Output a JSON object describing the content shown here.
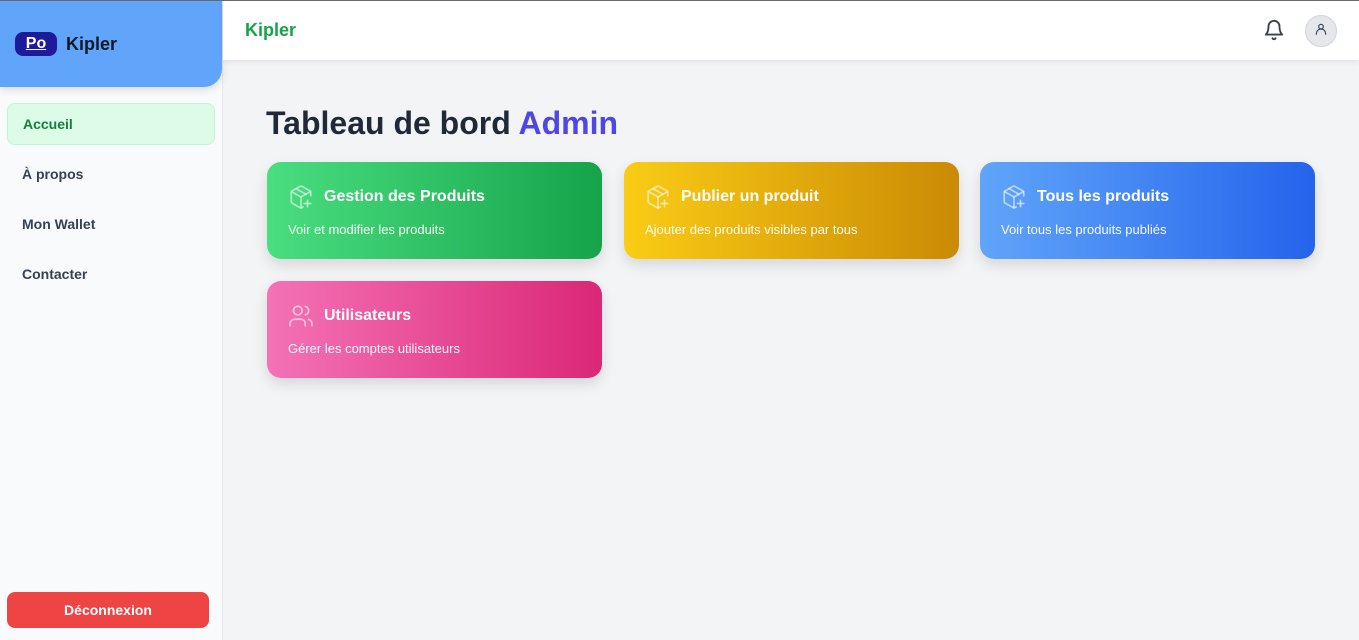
{
  "brand": {
    "logo_text": "Po",
    "name": "Kipler"
  },
  "sidebar": {
    "items": [
      {
        "label": "Accueil",
        "active": true
      },
      {
        "label": "À propos",
        "active": false
      },
      {
        "label": "Mon Wallet",
        "active": false
      },
      {
        "label": "Contacter",
        "active": false
      }
    ],
    "logout_label": "Déconnexion"
  },
  "header": {
    "title": "Kipler",
    "icons": [
      "bell-icon",
      "user-icon"
    ]
  },
  "main": {
    "title_prefix": "Tableau de bord",
    "title_accent": "Admin",
    "cards": [
      {
        "icon": "package-plus-icon",
        "title": "Gestion des Produits",
        "description": "Voir et modifier les produits",
        "color_from": "#4ade80",
        "color_to": "#16a34a"
      },
      {
        "icon": "package-plus-icon",
        "title": "Publier un produit",
        "description": "Ajouter des produits visibles par tous",
        "color_from": "#facc15",
        "color_to": "#ca8a04"
      },
      {
        "icon": "package-plus-icon",
        "title": "Tous les produits",
        "description": "Voir tous les produits publiés",
        "color_from": "#60a5fa",
        "color_to": "#2563eb"
      },
      {
        "icon": "users-icon",
        "title": "Utilisateurs",
        "description": "Gérer les comptes utilisateurs",
        "color_from": "#f472b6",
        "color_to": "#db2777"
      }
    ]
  },
  "colors": {
    "brand_bg": "#60a5fa",
    "header_title": "#16a34a",
    "accent": "#4f46e5",
    "active_nav_bg": "#dcfce7",
    "logout_bg": "#ef4444"
  }
}
